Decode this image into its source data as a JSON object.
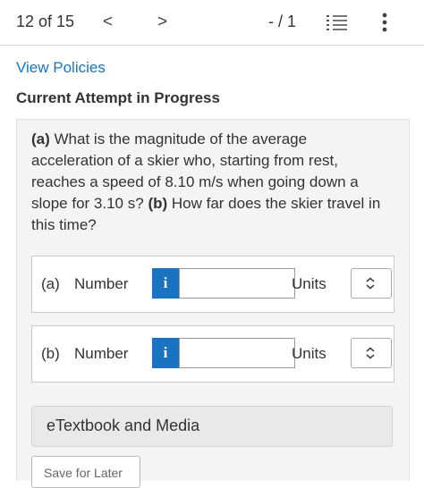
{
  "topbar": {
    "counter": "12 of 15",
    "prev_glyph": "<",
    "next_glyph": ">",
    "score": "- / 1"
  },
  "links": {
    "view_policies": "View Policies"
  },
  "attempt_status": "Current Attempt in Progress",
  "question": {
    "part_a_marker": "(a)",
    "part_a_text": "What is the magnitude of the average acceleration of a skier who, starting from rest, reaches a speed of 8.10 m/s when going down a slope for 3.10 s?",
    "part_b_marker": "(b)",
    "part_b_text": "How far does the skier travel in this time?"
  },
  "answers": [
    {
      "part": "(a)",
      "type_label": "Number",
      "info_glyph": "i",
      "value": "",
      "units_label": "Units",
      "units_value": ""
    },
    {
      "part": "(b)",
      "type_label": "Number",
      "info_glyph": "i",
      "value": "",
      "units_label": "Units",
      "units_value": ""
    }
  ],
  "buttons": {
    "etextbook": "eTextbook and Media",
    "save_for_later": "Save for Later"
  },
  "colors": {
    "accent": "#1a73c0",
    "card_bg": "#f4f4f4"
  },
  "icons": [
    "chevron-left-icon",
    "chevron-right-icon",
    "question-list-icon",
    "more-vertical-icon",
    "info-icon",
    "updown-chevron-icon"
  ]
}
